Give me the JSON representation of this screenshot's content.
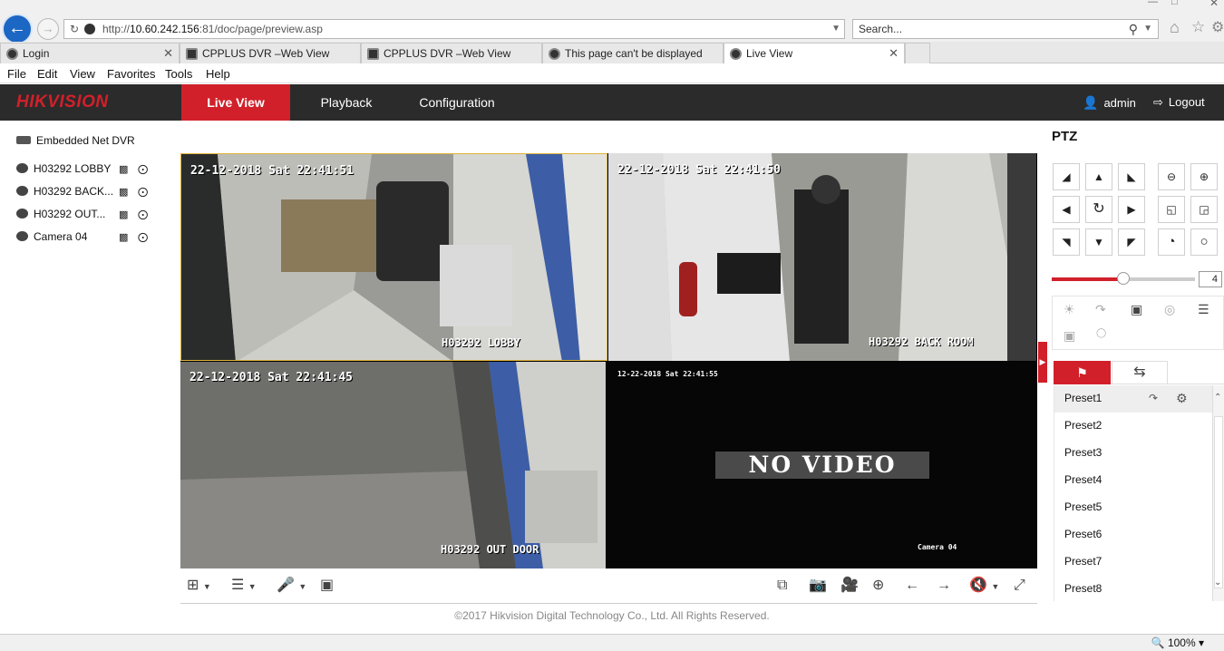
{
  "browser": {
    "url_prefix": "http://",
    "url_host": "10.60.242.156",
    "url_rest": ":81/doc/page/preview.asp",
    "search_placeholder": "Search...",
    "tabs": [
      {
        "label": "Login"
      },
      {
        "label": "CPPLUS DVR –Web View"
      },
      {
        "label": "CPPLUS DVR –Web View"
      },
      {
        "label": "This page can't be displayed"
      },
      {
        "label": "Live View"
      }
    ],
    "menu": [
      "File",
      "Edit",
      "View",
      "Favorites",
      "Tools",
      "Help"
    ],
    "zoom": "100%"
  },
  "app": {
    "logo": "HIKVISION",
    "nav": {
      "live": "Live View",
      "playback": "Playback",
      "config": "Configuration"
    },
    "user": "admin",
    "logout": "Logout",
    "accent": "#d1202a"
  },
  "tree": {
    "root": "Embedded Net DVR",
    "cameras": [
      "H03292 LOBBY",
      "H03292 BACK...",
      "H03292 OUT...",
      "Camera 04"
    ]
  },
  "video": {
    "cells": [
      {
        "timestamp": "22-12-2018 Sat 22:41:51",
        "label": "H03292 LOBBY"
      },
      {
        "timestamp": "22-12-2018 Sat 22:41:50",
        "label": "H03292 BACK ROOM"
      },
      {
        "timestamp": "22-12-2018 Sat 22:41:45",
        "label": "H03292 OUT DOOR"
      },
      {
        "timestamp": "12-22-2018 Sat 22:41:55",
        "label": "Camera 04",
        "message": "NO VIDEO"
      }
    ]
  },
  "footer": "©2017 Hikvision Digital Technology Co., Ltd. All Rights Reserved.",
  "ptz": {
    "title": "PTZ",
    "speed": "4",
    "speed_level": 0.5,
    "presets": [
      "Preset1",
      "Preset2",
      "Preset3",
      "Preset4",
      "Preset5",
      "Preset6",
      "Preset7",
      "Preset8"
    ]
  }
}
